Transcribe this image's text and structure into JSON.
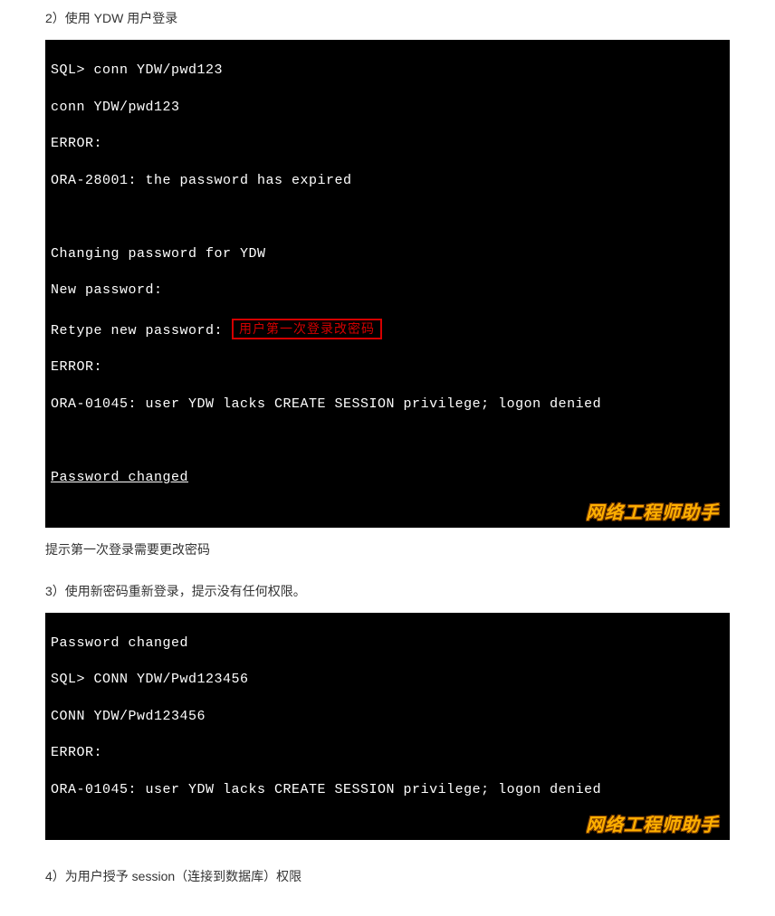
{
  "step2": {
    "heading": "2）使用 YDW 用户登录",
    "terminal": {
      "l1": "SQL> conn YDW/pwd123",
      "l2": "conn YDW/pwd123",
      "l3": "ERROR:",
      "l4": "ORA-28001: the password has expired",
      "l5": "",
      "l6": "",
      "l7": "Changing password for YDW",
      "l8": "New password:",
      "l9": "Retype new password:",
      "annotation": "用户第一次登录改密码",
      "l10": "ERROR:",
      "l11": "ORA-01045: user YDW lacks CREATE SESSION privilege; logon denied",
      "l12": "",
      "l13": "",
      "l14": "Password changed",
      "watermark": "网络工程师助手"
    },
    "caption": "提示第一次登录需要更改密码"
  },
  "step3": {
    "heading": "3）使用新密码重新登录，提示没有任何权限。",
    "terminal": {
      "l1": "Password changed",
      "l2": "SQL> CONN YDW/Pwd123456",
      "l3": "CONN YDW/Pwd123456",
      "l4": "ERROR:",
      "l5": "ORA-01045: user YDW lacks CREATE SESSION privilege; logon denied",
      "watermark": "网络工程师助手"
    }
  },
  "step4": {
    "heading": "4）为用户授予 session（连接到数据库）权限"
  }
}
